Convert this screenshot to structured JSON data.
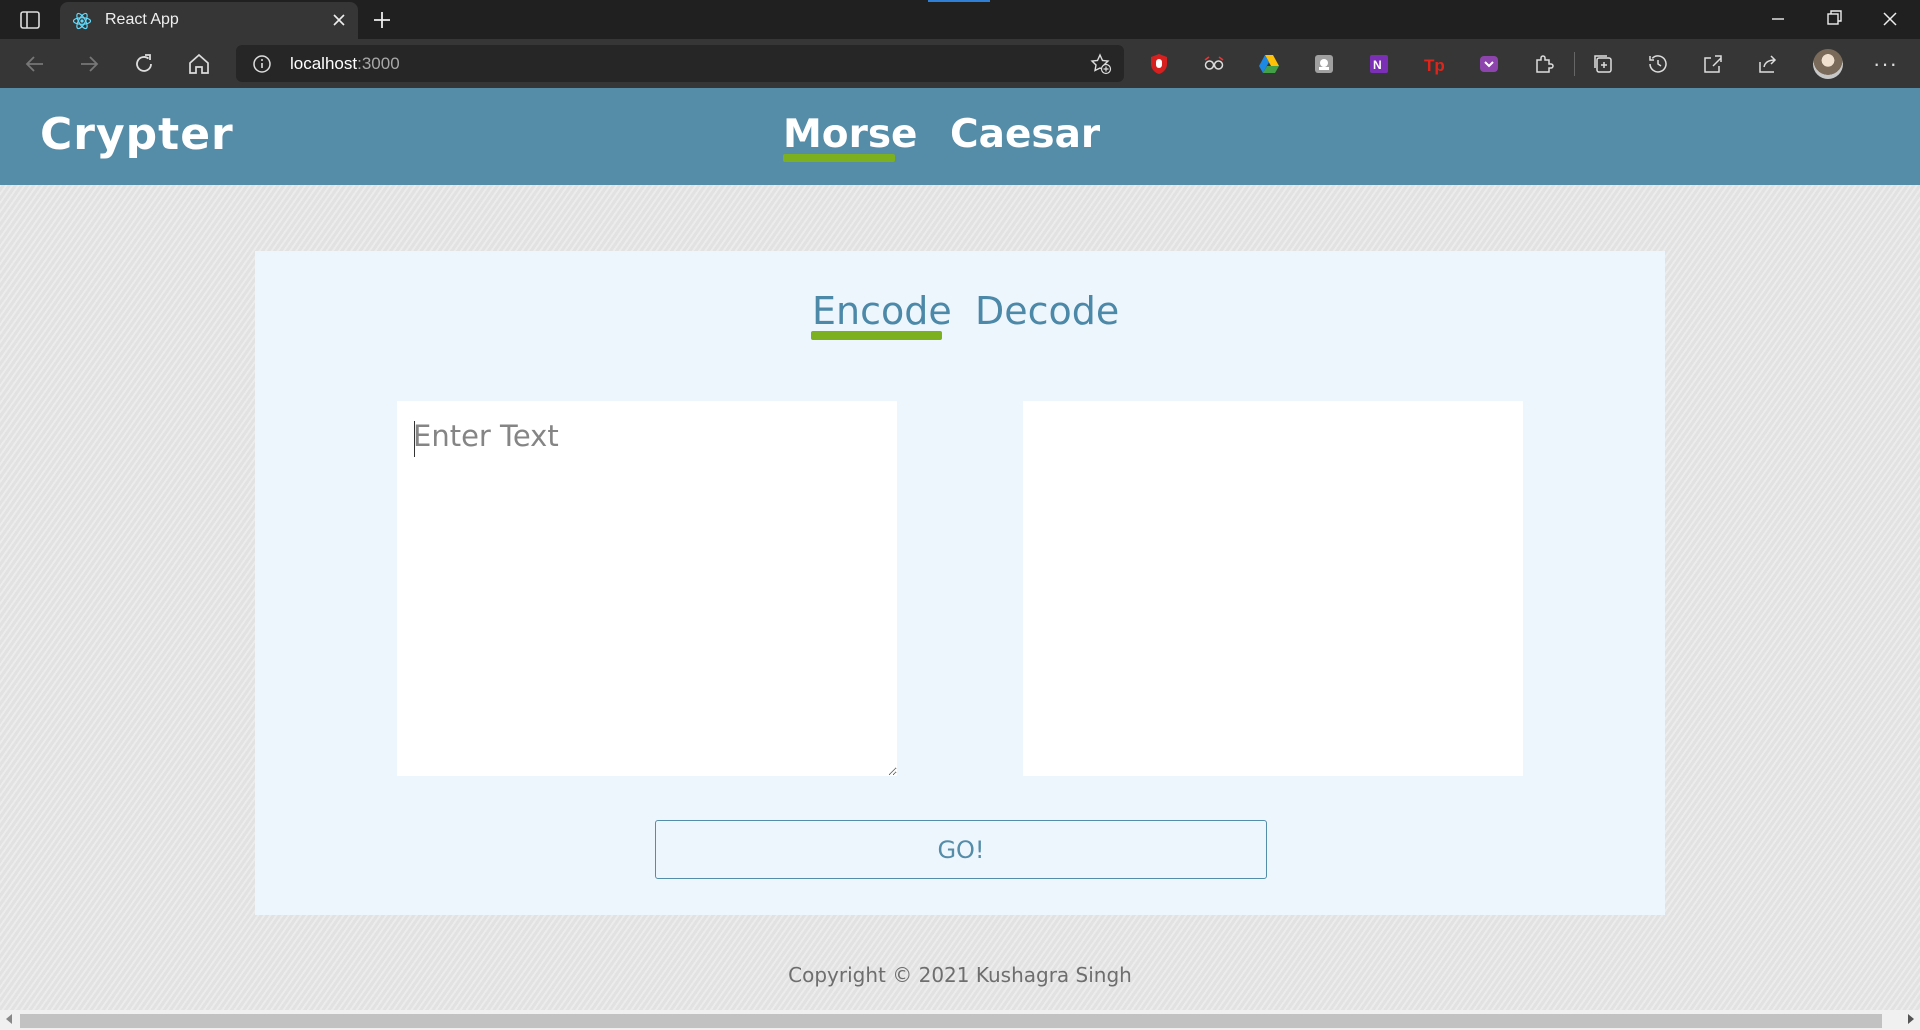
{
  "browser": {
    "tab_title": "React App",
    "address_host": "localhost",
    "address_port": ":3000"
  },
  "navbar": {
    "brand": "Crypter",
    "links": [
      "Morse",
      "Caesar"
    ],
    "active_link": "Morse"
  },
  "card": {
    "tabs": [
      "Encode",
      "Decode"
    ],
    "active_tab": "Encode",
    "input_placeholder": "Enter Text",
    "input_value": "",
    "output_value": "",
    "go_label": "GO!"
  },
  "footer": {
    "text": "Copyright © 2021 Kushagra Singh"
  },
  "colors": {
    "navbar": "#558ca8",
    "accent_green": "#7cb01f",
    "card_bg": "#eef6fd"
  }
}
